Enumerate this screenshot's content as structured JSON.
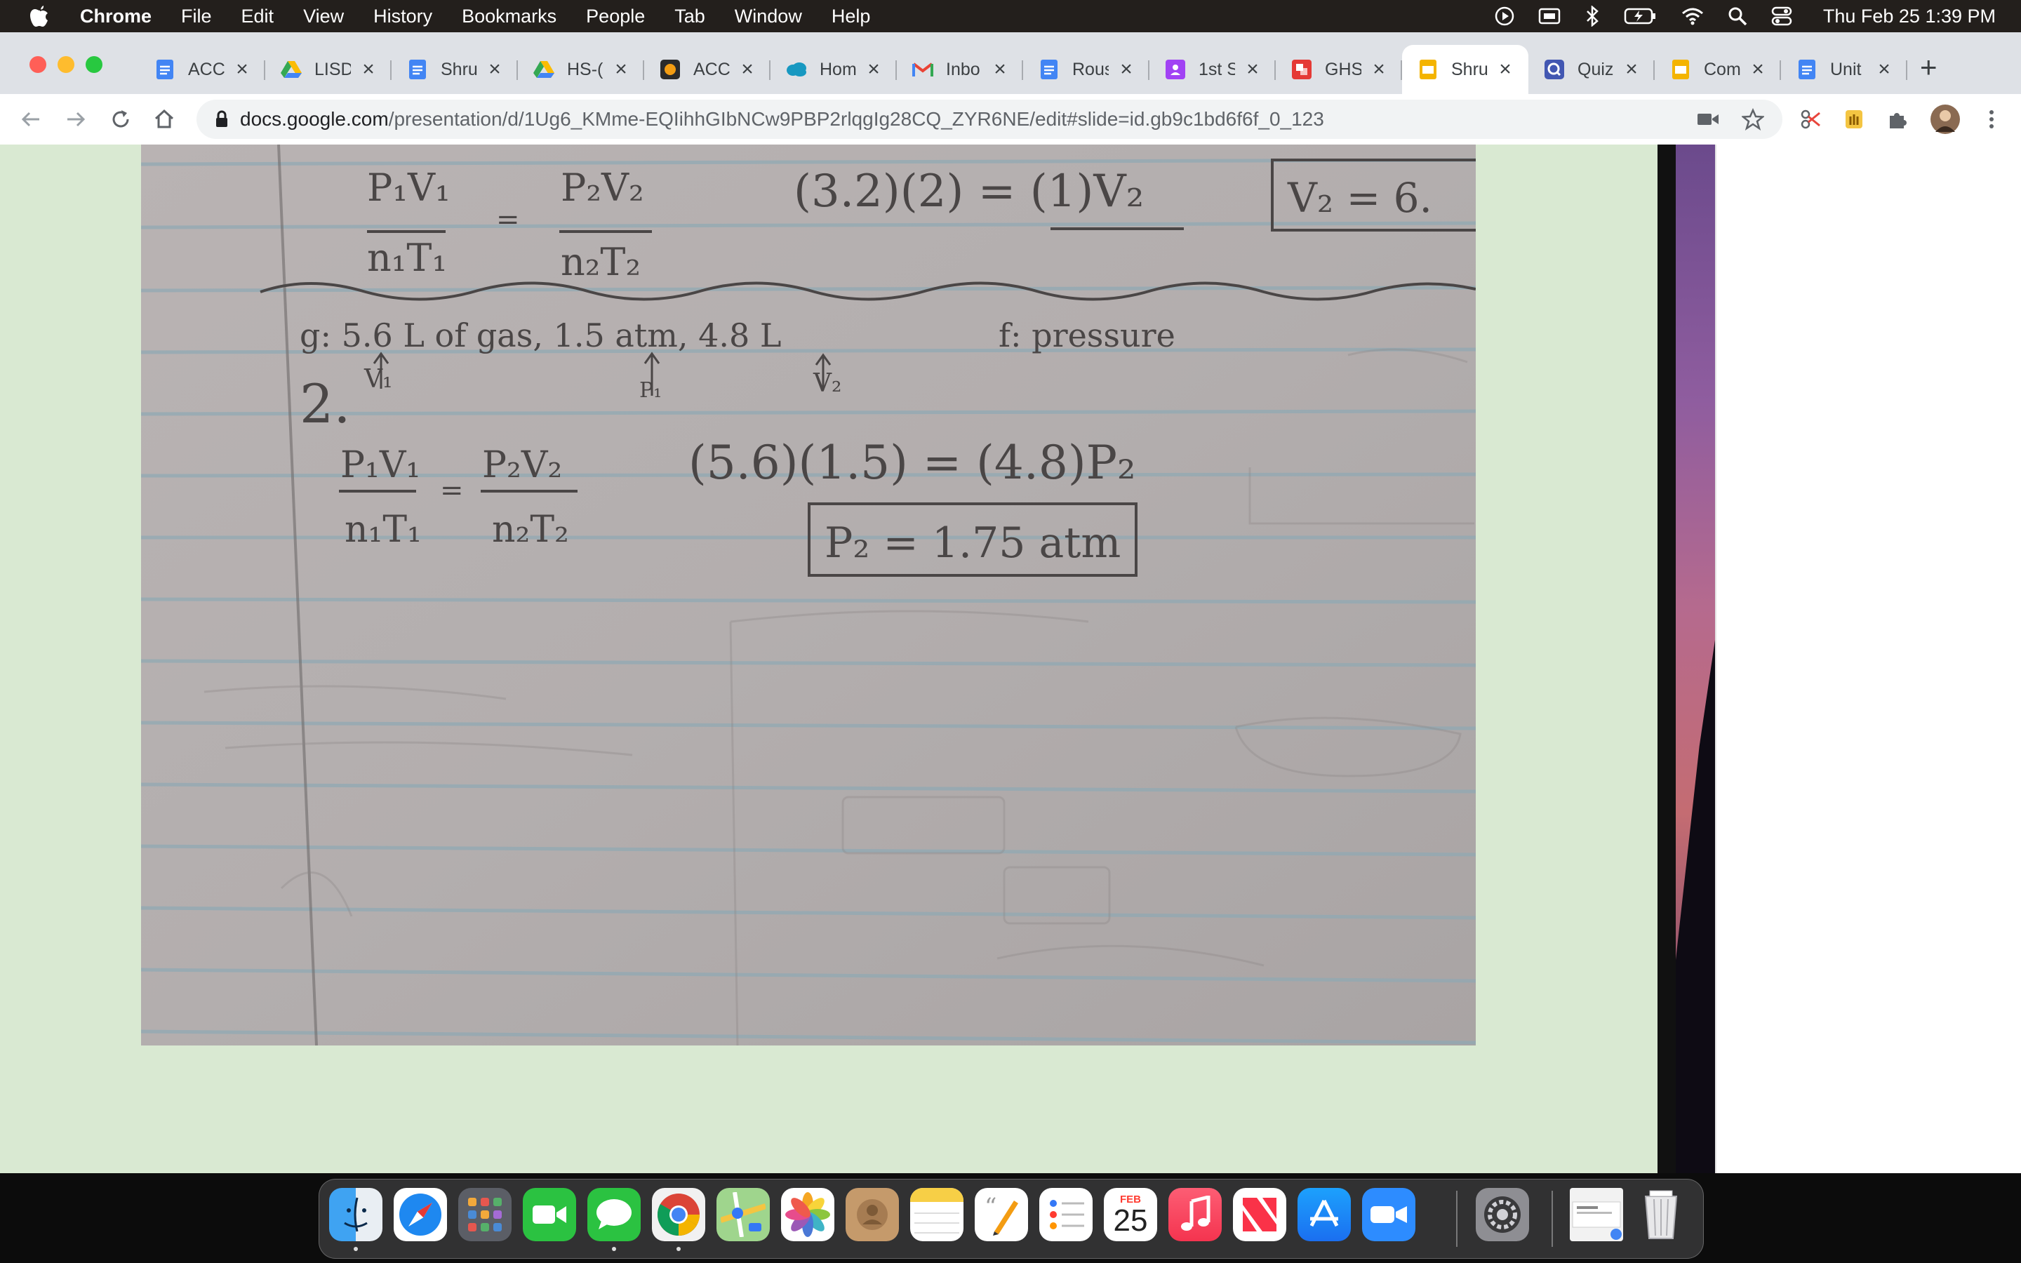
{
  "menubar": {
    "app": "Chrome",
    "items": [
      "File",
      "Edit",
      "View",
      "History",
      "Bookmarks",
      "People",
      "Tab",
      "Window",
      "Help"
    ],
    "clock": "Thu Feb 25  1:39 PM"
  },
  "tabs": [
    {
      "label": "ACC",
      "icon": "google-docs-icon"
    },
    {
      "label": "LISD",
      "icon": "google-drive-icon"
    },
    {
      "label": "Shru",
      "icon": "google-docs-icon"
    },
    {
      "label": "HS-(",
      "icon": "google-drive-icon"
    },
    {
      "label": "ACC",
      "icon": "app-icon"
    },
    {
      "label": "Hom",
      "icon": "salesforce-cloud-icon"
    },
    {
      "label": "Inbo",
      "icon": "gmail-icon"
    },
    {
      "label": "Rous",
      "icon": "google-docs-icon"
    },
    {
      "label": "1st S",
      "icon": "classroom-icon"
    },
    {
      "label": "GHS",
      "icon": "red-app-icon"
    },
    {
      "label": "Shru",
      "icon": "google-slides-icon",
      "active": true
    },
    {
      "label": "Quiz",
      "icon": "quizlet-icon"
    },
    {
      "label": "Com",
      "icon": "google-slides-icon"
    },
    {
      "label": "Unit",
      "icon": "google-docs-icon"
    }
  ],
  "address": {
    "domain": "docs.google.com",
    "path": "/presentation/d/1Ug6_KMme-EQIihhGIbNCw9PBP2rlqgIg28CQ_ZYR6NE/edit#slide=id.gb9c1bd6f6f_0_123"
  },
  "notes": {
    "top": {
      "eq_left_num": "P₁V₁",
      "eq_left_den": "n₁T₁",
      "eq_eq": "=",
      "eq_right_num": "P₂V₂",
      "eq_right_den": "n₂T₂",
      "subst": "(3.2)(2) = (1)V₂",
      "answer": "V₂ = 6."
    },
    "problem2": {
      "number": "2.",
      "given": "g: 5.6 L of gas, 1.5 atm, 4.8 L",
      "find": "f: pressure",
      "arrow_v1": "V₁",
      "arrow_p1": "P₁",
      "arrow_v2": "V₂",
      "eq_left_num": "P₁V₁",
      "eq_left_den": "n₁T₁",
      "eq_eq": "=",
      "eq_right_num": "P₂V₂",
      "eq_right_den": "n₂T₂",
      "subst": "(5.6)(1.5) = (4.8)P₂",
      "answer": "P₂ = 1.75 atm"
    }
  },
  "colors": {
    "slide_bg": "#d9e9d2",
    "paper": "#b7b2b1",
    "ink": "#4a4646"
  },
  "dock": [
    "finder-icon",
    "safari-icon",
    "launchpad-icon",
    "facetime-icon",
    "messages-icon",
    "chrome-icon",
    "maps-icon",
    "photos-icon",
    "contacts-icon",
    "notes-icon",
    "pages-icon",
    "reminders-icon",
    "calendar-icon",
    "music-icon",
    "news-icon",
    "app-store-icon",
    "zoom-icon",
    "system-preferences-icon",
    "document-thumbnail-icon",
    "trash-icon"
  ],
  "calendar": {
    "month": "FEB",
    "day": "25"
  }
}
